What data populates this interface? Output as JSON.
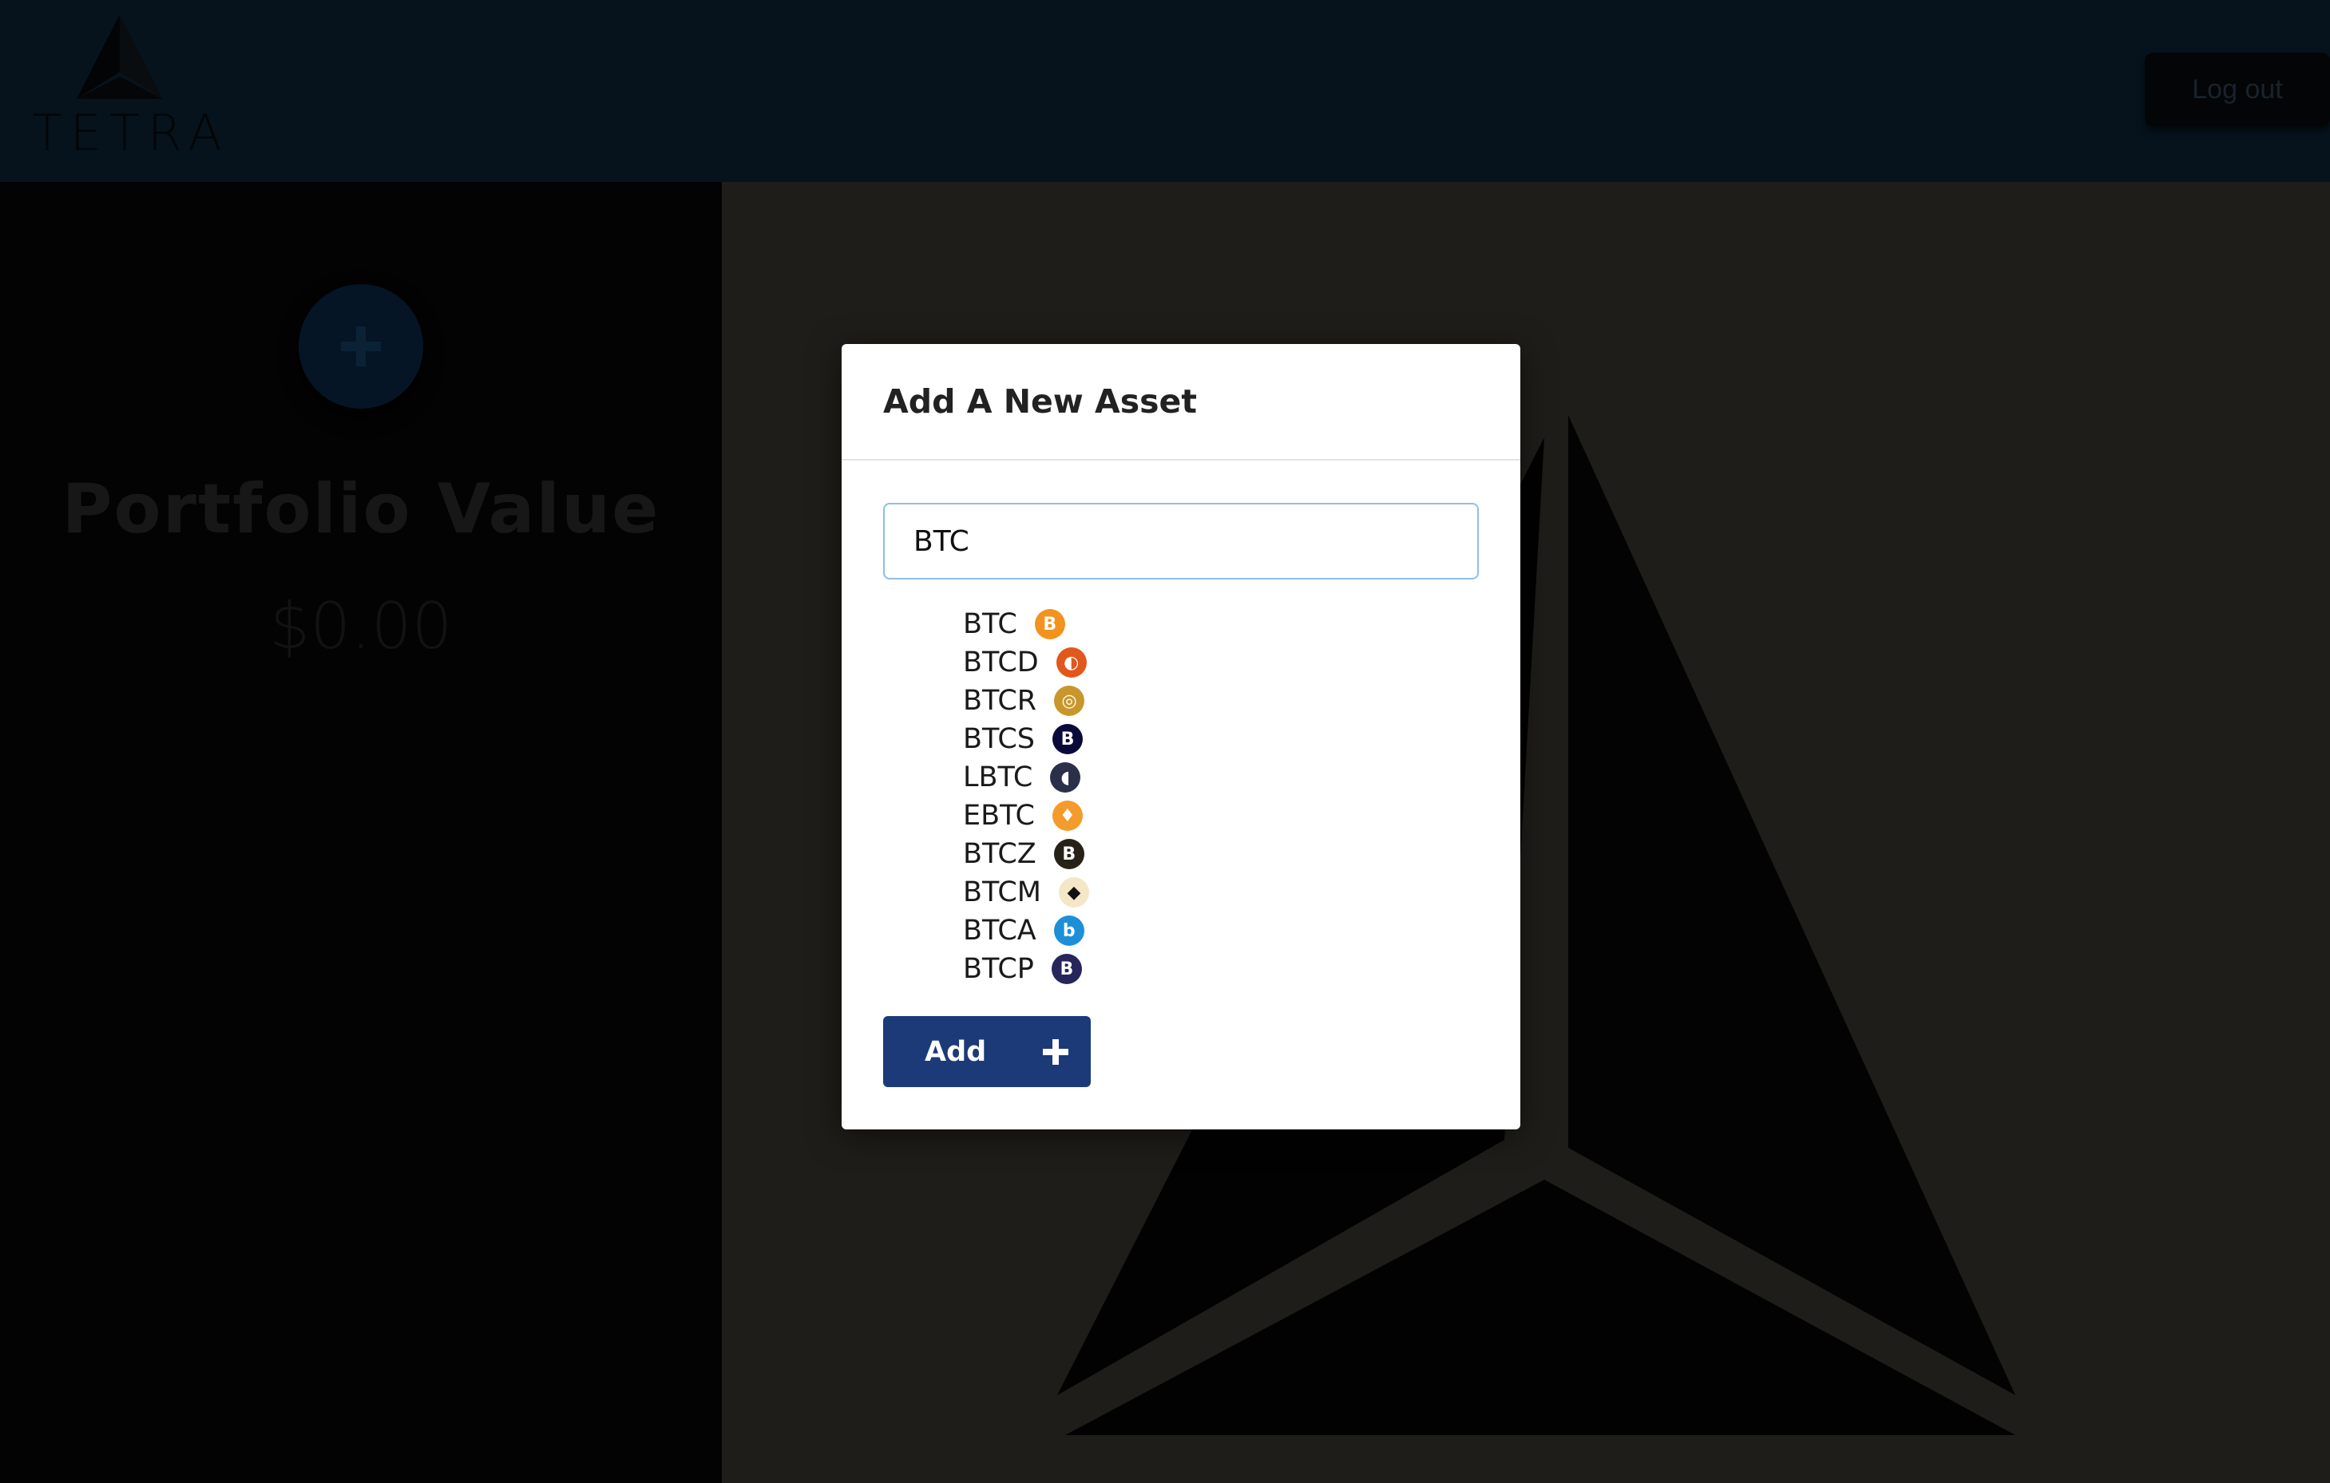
{
  "header": {
    "brand": "TETRA",
    "logout_label": "Log out"
  },
  "sidebar": {
    "add_icon": "plus-icon",
    "portfolio_title": "Portfolio Value",
    "portfolio_amount": "$0.00"
  },
  "modal": {
    "title": "Add A New Asset",
    "search_value": "BTC",
    "results": [
      {
        "symbol": "BTC",
        "icon_color": "#f2931f",
        "icon_glyph": "B"
      },
      {
        "symbol": "BTCD",
        "icon_color": "#e2571c",
        "icon_glyph": "◐"
      },
      {
        "symbol": "BTCR",
        "icon_color": "#c9962b",
        "icon_glyph": "◎"
      },
      {
        "symbol": "BTCS",
        "icon_color": "#0a0a3a",
        "icon_glyph": "B"
      },
      {
        "symbol": "LBTC",
        "icon_color": "#2b2f4a",
        "icon_glyph": "◖"
      },
      {
        "symbol": "EBTC",
        "icon_color": "#f49b2b",
        "icon_glyph": "♦"
      },
      {
        "symbol": "BTCZ",
        "icon_color": "#272218",
        "icon_glyph": "B"
      },
      {
        "symbol": "BTCM",
        "icon_color": "#f3e7c7",
        "icon_glyph": "◆"
      },
      {
        "symbol": "BTCA",
        "icon_color": "#1d8fd8",
        "icon_glyph": "b"
      },
      {
        "symbol": "BTCP",
        "icon_color": "#26265a",
        "icon_glyph": "B"
      }
    ],
    "add_label": "Add"
  },
  "colors": {
    "accent": "#1c3a78",
    "topbar": "#06131d",
    "main_bg": "#1f1d19"
  }
}
